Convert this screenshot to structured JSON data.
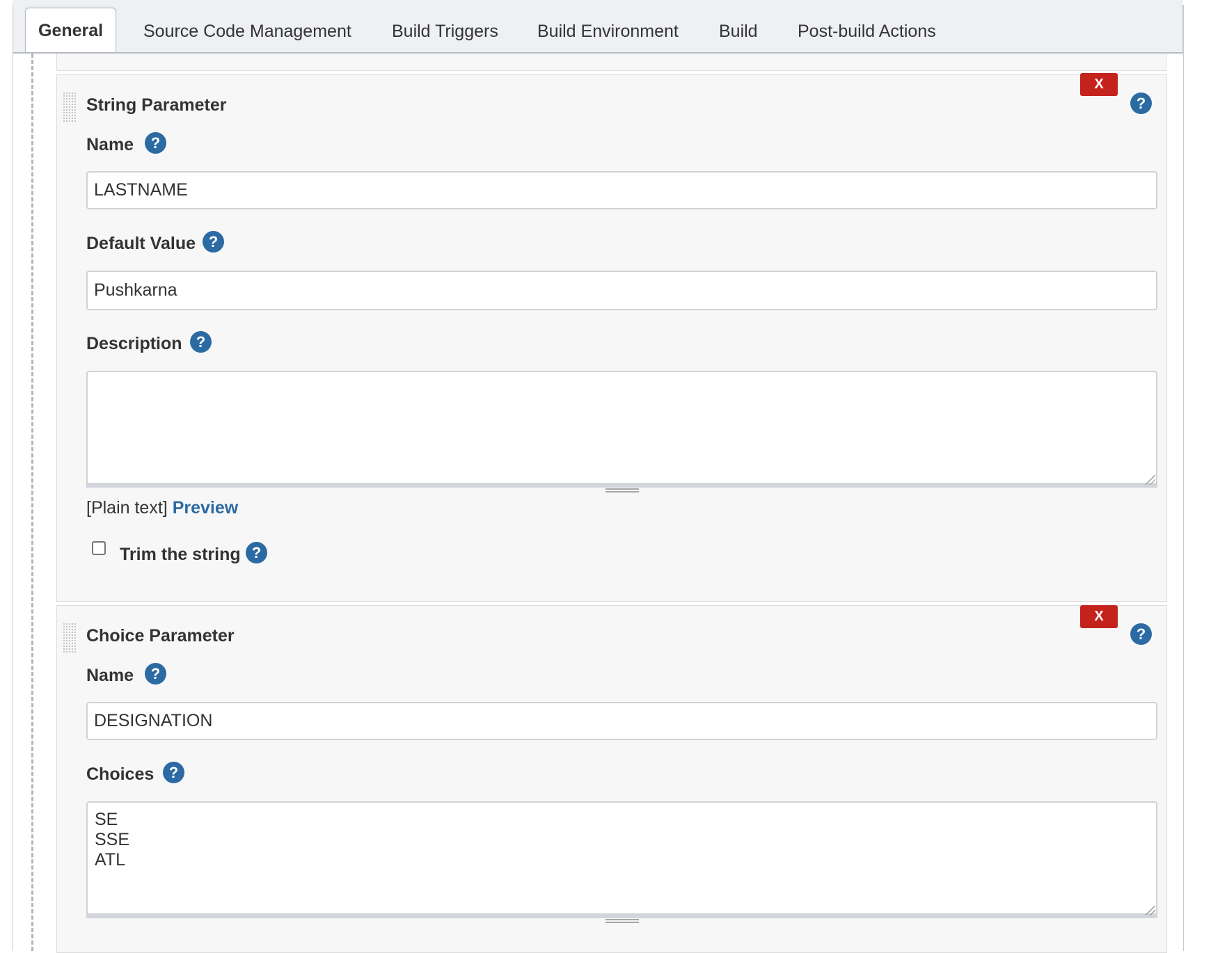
{
  "tabs": [
    {
      "label": "General",
      "active": true
    },
    {
      "label": "Source Code Management",
      "active": false
    },
    {
      "label": "Build Triggers",
      "active": false
    },
    {
      "label": "Build Environment",
      "active": false
    },
    {
      "label": "Build",
      "active": false
    },
    {
      "label": "Post-build Actions",
      "active": false
    }
  ],
  "icons": {
    "help": "?",
    "delete": "X"
  },
  "colors": {
    "delete_button": "#c4231c",
    "help_icon": "#2b6aa3",
    "link": "#2b6aa3"
  },
  "string_parameter": {
    "title": "String Parameter",
    "name_label": "Name",
    "name_value": "LASTNAME",
    "default_label": "Default Value",
    "default_value": "Pushkarna",
    "description_label": "Description",
    "description_value": "",
    "format_text": "[Plain text]",
    "preview_label": "Preview",
    "trim_label": "Trim the string",
    "trim_checked": false
  },
  "choice_parameter": {
    "title": "Choice Parameter",
    "name_label": "Name",
    "name_value": "DESIGNATION",
    "choices_label": "Choices",
    "choices_value": "SE\nSSE\nATL"
  }
}
